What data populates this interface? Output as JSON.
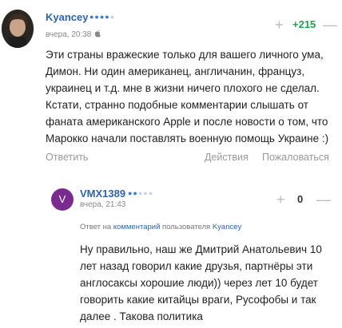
{
  "comment1": {
    "author": "Kyancey",
    "rank_dots_on": "●●●●",
    "rank_dots_off": "●",
    "time": "вчера, 20:38",
    "votes": {
      "plus": "+",
      "count": "+215",
      "minus": "—"
    },
    "text_lines": [
      "Эти страны вражеские только для вашего личного ума,",
      "Димон. Ни один американец, англичанин, француз,",
      "украинец и т.д. мне в жизни ничего плохого не сделал.",
      "Кстати, странно подобные комментарии слышать от",
      "фаната американского Apple и после новости о том, что",
      "Марокко начали поставлять военную помощь Украине :)"
    ],
    "actions": {
      "reply": "Ответить",
      "actions": "Действия",
      "complain": "Пожаловаться"
    }
  },
  "comment2": {
    "avatar_letter": "V",
    "author": "VMX1389",
    "rank_dots_on": "●●",
    "rank_dots_off": "●●●",
    "time": "вчера, 21:43",
    "votes": {
      "plus": "+",
      "count": "0",
      "minus": "—"
    },
    "reply_note": {
      "prefix": "Ответ на",
      "link": "комментарий",
      "middle": "пользователя",
      "user": "Kyancey"
    },
    "text_lines": [
      "Ну правильно, наш же Дмитрий Анатольевич 10",
      "лет назад говорил какие друзья, партнёры эти",
      "англосаксы хорошие люди)) через лет 10 будет",
      "говорить какие китайцы враги, Русофобы и так",
      "далее . Такова политика"
    ]
  },
  "colors": {
    "accent": "#2f64a8",
    "positive": "#2e9b4d",
    "muted": "#999999",
    "avatar_bg": "#7a2b8f"
  }
}
